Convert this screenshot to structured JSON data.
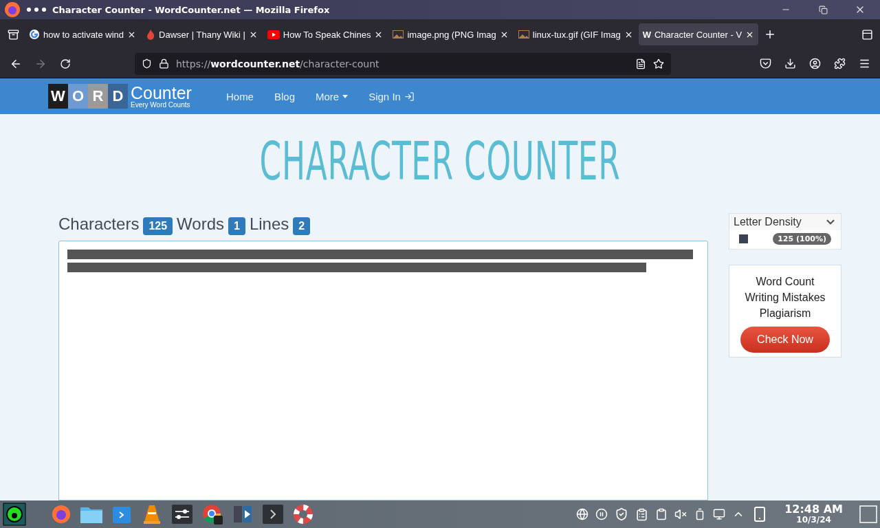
{
  "window": {
    "title": "Character Counter - WordCounter.net — Mozilla Firefox"
  },
  "tabs": [
    {
      "label": "how to activate wind",
      "kind": "google",
      "selected": false
    },
    {
      "label": "Dawser | Thany Wiki |",
      "kind": "wiki",
      "selected": false
    },
    {
      "label": "How To Speak Chines",
      "kind": "video",
      "selected": false
    },
    {
      "label": "image.png (PNG Imag",
      "kind": "image",
      "selected": false
    },
    {
      "label": "linux-tux.gif (GIF Imag",
      "kind": "image",
      "selected": false
    },
    {
      "label": "Character Counter - V",
      "kind": "letter",
      "favicon_text": "W",
      "selected": true
    }
  ],
  "url": {
    "scheme": "https://",
    "host": "wordcounter.net",
    "path": "/character-count"
  },
  "site": {
    "logo_letters": [
      "W",
      "O",
      "R",
      "D"
    ],
    "logo_word": "Counter",
    "tagline": "Every Word Counts",
    "nav": [
      {
        "label": "Home",
        "kind": "link"
      },
      {
        "label": "Blog",
        "kind": "link"
      },
      {
        "label": "More",
        "kind": "dropdown"
      },
      {
        "label": "Sign In",
        "kind": "signin"
      }
    ]
  },
  "page_title": "CHARACTER COUNTER",
  "stats": [
    {
      "label": "Characters",
      "value": "125"
    },
    {
      "label": "Words",
      "value": "1"
    },
    {
      "label": "Lines",
      "value": "2"
    }
  ],
  "letter_density": {
    "title": "Letter Density",
    "expanded": true,
    "rows": [
      {
        "color": "#3b4256",
        "value": "125 (100%)"
      }
    ]
  },
  "promo": {
    "lines": [
      "Word Count",
      "Writing Mistakes",
      "Plagiarism"
    ],
    "button": "Check Now"
  },
  "clock": {
    "time": "12:48 AM",
    "date": "10/3/24"
  }
}
